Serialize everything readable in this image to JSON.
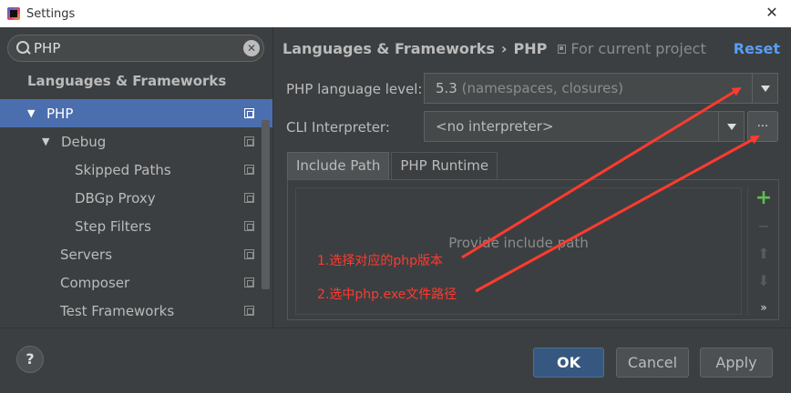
{
  "window": {
    "title": "Settings"
  },
  "search": {
    "value": "PHP"
  },
  "tree": {
    "section_title": "Languages & Frameworks",
    "items": [
      {
        "label": "PHP",
        "expanded": true,
        "selected": true
      },
      {
        "label": "Debug",
        "expanded": true
      },
      {
        "label": "Skipped Paths"
      },
      {
        "label": "DBGp Proxy"
      },
      {
        "label": "Step Filters"
      },
      {
        "label": "Servers"
      },
      {
        "label": "Composer"
      },
      {
        "label": "Test Frameworks"
      }
    ]
  },
  "header": {
    "breadcrumb_parent": "Languages & Frameworks",
    "breadcrumb_separator": "›",
    "breadcrumb_current": "PHP",
    "scope": "For current project",
    "reset_label": "Reset"
  },
  "form": {
    "language_level_label": "PHP language level:",
    "language_level_value": "5.3",
    "language_level_hint": "(namespaces, closures)",
    "cli_label": "CLI Interpreter:",
    "cli_value": "<no interpreter>",
    "browse_label": "..."
  },
  "tabs": [
    {
      "label": "Include Path",
      "active": true
    },
    {
      "label": "PHP Runtime",
      "active": false
    }
  ],
  "include_path": {
    "empty_text": "Provide include path",
    "toolbar": {
      "add": "+",
      "remove": "−",
      "up": "⬆",
      "down": "⬇",
      "more": "»"
    }
  },
  "annotations": {
    "note1": "1.选择对应的php版本",
    "note2": "2.选中php.exe文件路径",
    "color": "#ff3a2f"
  },
  "footer": {
    "help": "?",
    "ok": "OK",
    "cancel": "Cancel",
    "apply": "Apply"
  },
  "colors": {
    "background": "#3c3f41",
    "selection": "#4b6eaf",
    "accent": "#589df6",
    "primary_button": "#365880",
    "add_green": "#5bbf4f"
  }
}
